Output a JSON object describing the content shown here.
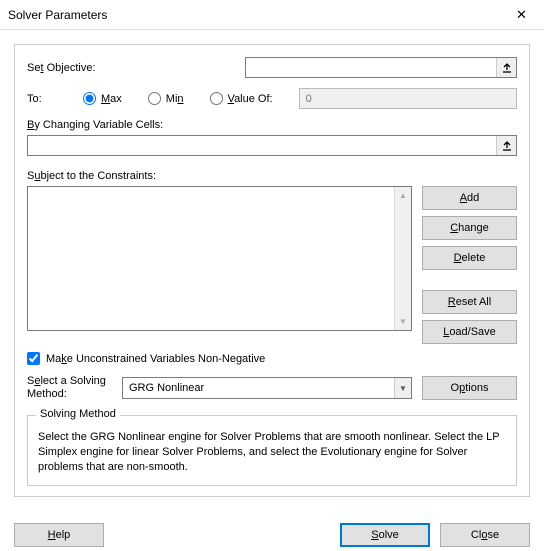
{
  "window": {
    "title": "Solver Parameters",
    "close": "✕"
  },
  "labels": {
    "setObjective": "Set Objective:",
    "to": "To:",
    "valueOfNum": "0",
    "byChanging": "y Changing Variable Cells:",
    "byChangingU": "B",
    "subjectTo": "Subject to the Constraints:",
    "subjectToU": "",
    "makeNonNeg": "e Unconstrained Variables Non-Negative",
    "makeNonNegU": "Mak",
    "selectMethodU": "E",
    "selectMethod": "lect a Solving Method:",
    "selectMethodPre": "S",
    "solvingMethod": "Solving Method",
    "desc": "Select the GRG Nonlinear engine for Solver Problems that are smooth nonlinear. Select the LP Simplex engine for linear Solver Problems, and select the Evolutionary engine for Solver problems that are non-smooth."
  },
  "radios": {
    "max": "ax",
    "maxU": "M",
    "min": "Min",
    "minU": "",
    "valueOf": "alue Of:",
    "valueOfU": "V"
  },
  "btns": {
    "add": "dd",
    "addU": "A",
    "change": "hange",
    "changeU": "C",
    "delete": "elete",
    "deleteU": "D",
    "resetAll": "eset All",
    "resetAllU": "R",
    "loadSave": "oad/Save",
    "loadSaveU": "L",
    "options": "ptions",
    "optionsU": "O",
    "help": "elp",
    "helpU": "H",
    "solve": "olve",
    "solveU": "S",
    "close": "se",
    "closeU": "o",
    "closePre": "Cl"
  },
  "combo": {
    "value": "GRG Nonlinear"
  }
}
